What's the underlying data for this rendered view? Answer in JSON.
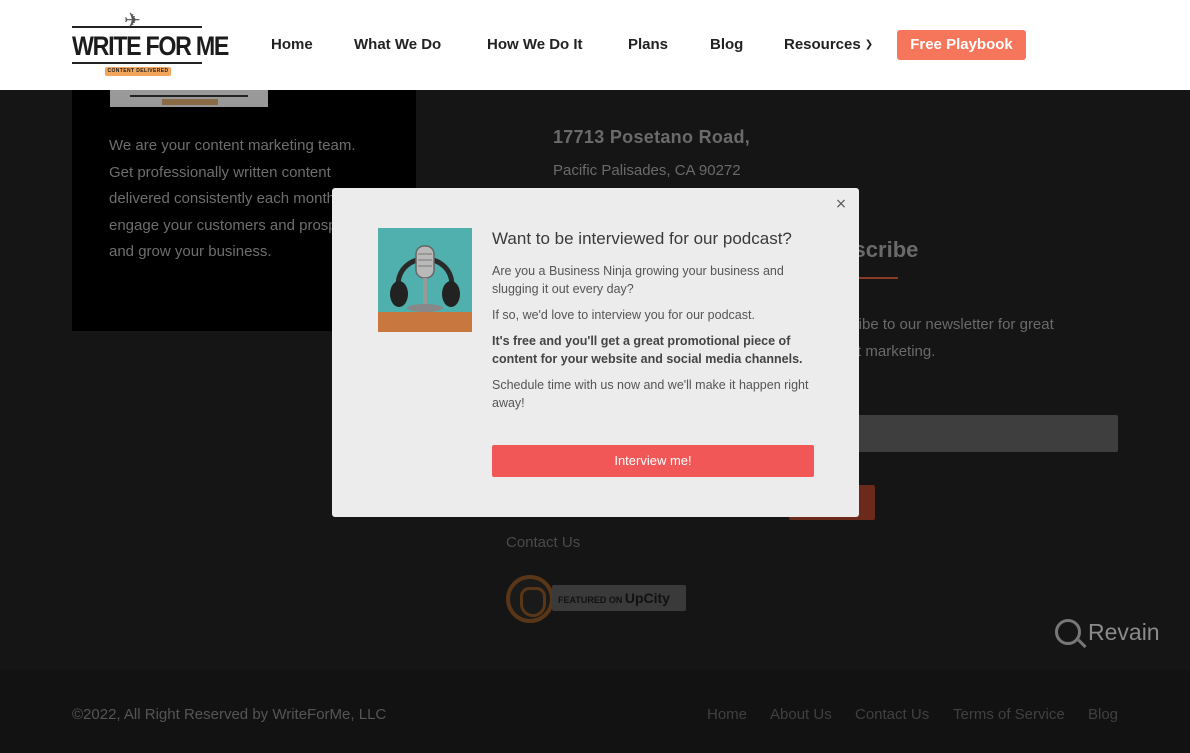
{
  "header": {
    "logo": {
      "wordmark": "WRITE FOR ME",
      "tagline": "CONTENT DELIVERED"
    },
    "nav": [
      {
        "label": "Home"
      },
      {
        "label": "What We Do"
      },
      {
        "label": "How We Do It"
      },
      {
        "label": "Plans"
      },
      {
        "label": "Blog"
      },
      {
        "label": "Resources",
        "dropdown": true
      }
    ],
    "cta_label": "Free Playbook",
    "colors": {
      "cta": "#f5765b"
    }
  },
  "about": {
    "lines": [
      "We are your content marketing team.",
      "Get professionally written content",
      "delivered consistently each month to",
      "engage your customers and prospects",
      "and grow your business."
    ]
  },
  "address": {
    "street": "17713 Posetano Road,",
    "city": "Pacific Palisades, CA 90272"
  },
  "subscribe": {
    "title": "Subscribe",
    "lines": [
      "Subscribe to our newsletter for great",
      "content marketing."
    ]
  },
  "contact_link": "Contact Us",
  "upcity": {
    "featured_on": "FEATURED ON",
    "brand": "UpCity"
  },
  "footer": {
    "copyright": "©2022, All Right Reserved by WriteForMe, LLC",
    "links": [
      {
        "label": "Home"
      },
      {
        "label": "About Us"
      },
      {
        "label": "Contact Us"
      },
      {
        "label": "Terms of Service"
      },
      {
        "label": "Blog"
      }
    ]
  },
  "watermark": "Revain",
  "modal": {
    "title": "Want to be interviewed for our podcast?",
    "close_glyph": "×",
    "paragraphs": [
      "Are you a Business Ninja growing your business and slugging it out every day?",
      "If so, we'd love to interview you for our podcast.",
      "It's free and you'll get a great promotional piece of content for your website and social media channels.",
      "Schedule time with us now and we'll make it happen right away!"
    ],
    "button_label": "Interview me!",
    "colors": {
      "button": "#f15757"
    }
  }
}
